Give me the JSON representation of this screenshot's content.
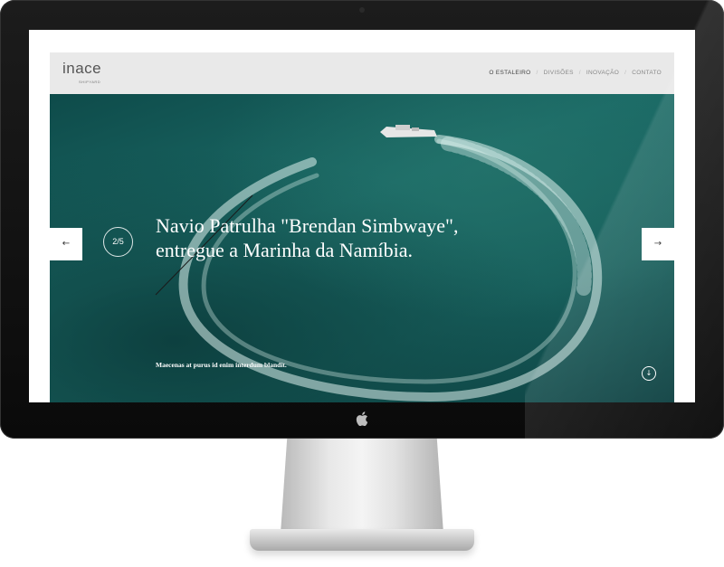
{
  "site": {
    "logo_text": "inace",
    "logo_sub": "SHIPYARD"
  },
  "nav": {
    "items": [
      "O ESTALEIRO",
      "DIVISÕES",
      "INOVAÇÃO",
      "CONTATO"
    ],
    "separator": "/"
  },
  "slide": {
    "counter": "2/5",
    "headline_line1": "Navio Patrulha \"Brendan Simbwaye\",",
    "headline_line2": "entregue a Marinha da Namíbia.",
    "caption": "Maecenas at purus id enim interdum blandit."
  },
  "icons": {
    "prev": "arrow-left-icon",
    "next": "arrow-right-icon",
    "scroll": "arrow-down-circle-icon",
    "apple": "apple-logo-icon"
  },
  "glyphs": {
    "prev": "←",
    "next": "→",
    "scroll": "↓",
    "apple": ""
  },
  "colors": {
    "sea": "#175e5b",
    "header_bg": "#e9e9e9",
    "bezel": "#111111",
    "text_light": "#ffffff"
  }
}
